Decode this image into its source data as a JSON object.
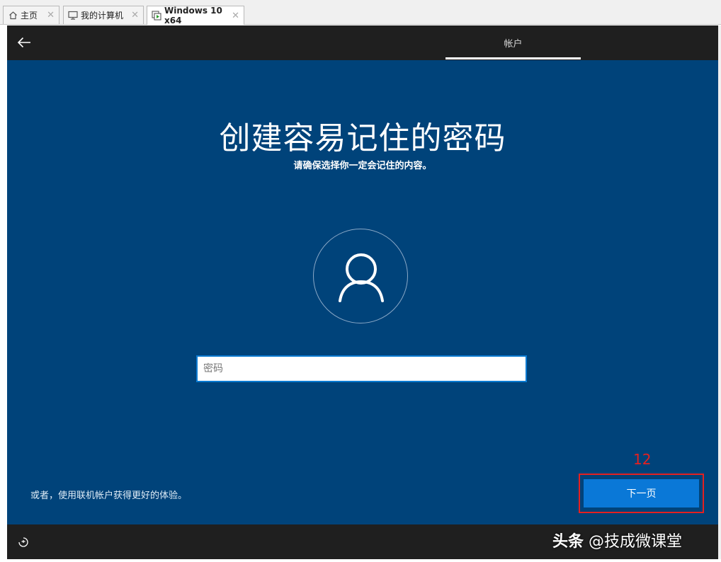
{
  "tabs": [
    {
      "label": "主页",
      "icon": "home-icon"
    },
    {
      "label": "我的计算机",
      "icon": "computer-icon"
    },
    {
      "label": "Windows 10 x64",
      "icon": "vm-icon",
      "active": true
    }
  ],
  "vm": {
    "header_tab": "帐户",
    "title": "创建容易记住的密码",
    "subtitle": "请确保选择你一定会记住的内容。",
    "password_placeholder": "密码",
    "online_account_link": "或者，使用联机帐户获得更好的体验。",
    "next_button": "下一页",
    "step_annotation": "12",
    "watermark_brand": "头条",
    "watermark_author": "@技成微课堂"
  },
  "colors": {
    "panel_bg": "#00437a",
    "bar_bg": "#1f1f1f",
    "button_bg": "#0a78d7",
    "annotation_red": "#e52020"
  }
}
